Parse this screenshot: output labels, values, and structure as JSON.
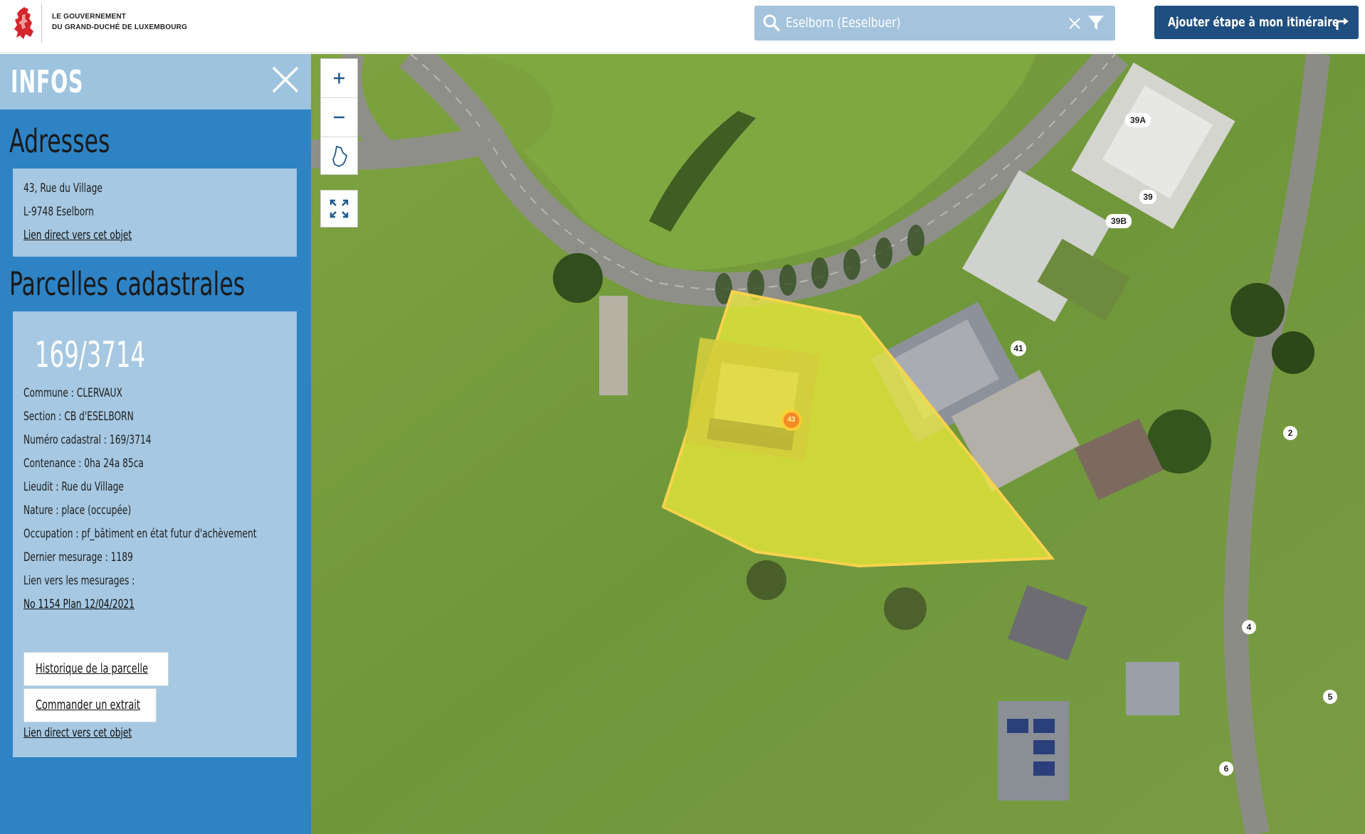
{
  "header": {
    "logo_line1": "LE GOUVERNEMENT",
    "logo_line2": "DU GRAND-DUCHÉ DE LUXEMBOURG",
    "search_value": "Eselborn (Eeselbuer)",
    "route_button_label": "Ajouter étape à mon itinéraire"
  },
  "sidebar": {
    "title": "INFOS",
    "addresses": {
      "heading": "Adresses",
      "street": "43, Rue du Village",
      "locality": "L-9748 Eselborn",
      "direct_link": "Lien direct vers cet objet"
    },
    "parcels": {
      "heading": "Parcelles cadastrales",
      "number": "169/3714",
      "commune": "Commune : CLERVAUX",
      "section": "Section : CB d'ESELBORN",
      "cadastral_number": "Numéro cadastral : 169/3714",
      "area": "Contenance : 0ha 24a 85ca",
      "lieudit": "Lieudit : Rue du Village",
      "nature": "Nature : place (occupée)",
      "occupation": "Occupation : pf_bâtiment en état futur d'achèvement",
      "last_survey": "Dernier mesurage : 1189",
      "survey_links_label": "Lien vers les mesurages :",
      "survey_link": "No 1154 Plan 12/04/2021",
      "history_button": "Historique de la parcelle",
      "order_button": "Commander un extrait",
      "direct_link": "Lien direct vers cet objet"
    }
  },
  "map": {
    "zoom_in": "+",
    "zoom_out": "−",
    "labels": [
      "39A",
      "39",
      "39B",
      "41",
      "2",
      "4",
      "5",
      "6",
      "43"
    ],
    "highlight_color": "#f3f03a",
    "icons": [
      "search-icon",
      "close-icon",
      "filter-icon",
      "route-arrow-icon",
      "zoom-in-icon",
      "zoom-out-icon",
      "country-outline-icon",
      "fullscreen-icon"
    ]
  }
}
